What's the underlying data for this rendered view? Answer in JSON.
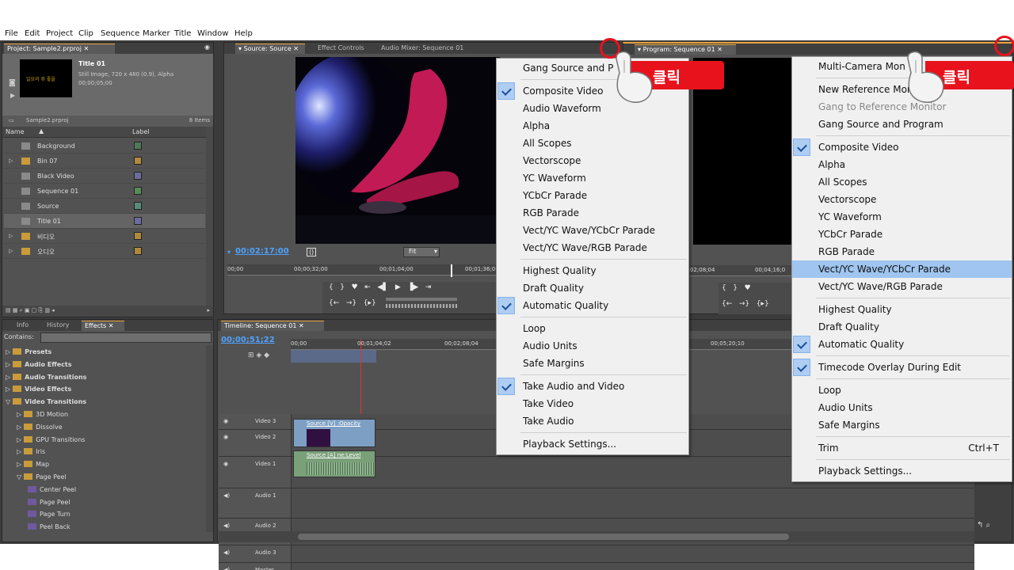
{
  "menubar": [
    "File",
    "Edit",
    "Project",
    "Clip",
    "Sequence",
    "Marker",
    "Title",
    "Window",
    "Help"
  ],
  "project": {
    "tab": "Project: Sample2.prproj",
    "title": "Title 01",
    "info1": "Still Image, 720 x 480 (0.9), Alpha",
    "info2": "00;00;05;00",
    "filename": "Sample2.prproj",
    "count": "8 Items",
    "col_name": "Name",
    "col_label": "Label",
    "items": [
      {
        "name": "Background",
        "color": "#4f7a5a"
      },
      {
        "name": "Bin 07",
        "color": "#b08a3a"
      },
      {
        "name": "Black Video",
        "color": "#6c6ca0"
      },
      {
        "name": "Sequence 01",
        "color": "#5a8a5a"
      },
      {
        "name": "Source",
        "color": "#5a8a7a"
      },
      {
        "name": "Title 01",
        "color": "#6c6ca0"
      },
      {
        "name": "비디오",
        "color": "#b08a3a"
      },
      {
        "name": "오디오",
        "color": "#b08a3a"
      }
    ]
  },
  "effects": {
    "tabs": [
      "Info",
      "History",
      "Effects"
    ],
    "contains": "Contains:",
    "items": [
      "Presets",
      "Audio Effects",
      "Audio Transitions",
      "Video Effects",
      "Video Transitions",
      "3D Motion",
      "Dissolve",
      "GPU Transitions",
      "Iris",
      "Map",
      "Page Peel",
      "Center Peel",
      "Page Peel",
      "Page Turn",
      "Peel Back"
    ]
  },
  "source": {
    "tabs": [
      "Source: Source",
      "Effect Controls",
      "Audio Mixer: Sequence 01"
    ],
    "timecode": "00:02:17:00",
    "fit": "Fit",
    "ruler": [
      "00;00",
      "00;00;32;00",
      "00;01;04;00",
      "00;01;36;0"
    ]
  },
  "program": {
    "tab": "Program: Sequence 01",
    "ruler": [
      "02;08;04",
      "00;04;16;0"
    ]
  },
  "timeline": {
    "tab": "Timeline: Sequence 01",
    "timecode": "00;00;51;22",
    "ruler": [
      "00;00",
      "00;01;04;02",
      "00;02;08;04",
      "00;05;20;10"
    ],
    "tracks": [
      "Video 3",
      "Video 2",
      "Video 1",
      "Audio 1",
      "Audio 2",
      "Audio 3",
      "Master"
    ],
    "clip_v1": "Source [V] :Opacity",
    "clip_a1": "Source [A] ne:Level"
  },
  "menu_left": {
    "items": [
      {
        "label": "Gang Source and P",
        "checked": false
      },
      {
        "label": "Composite Video",
        "checked": true
      },
      {
        "label": "Audio Waveform",
        "checked": false
      },
      {
        "label": "Alpha",
        "checked": false
      },
      {
        "label": "All Scopes",
        "checked": false
      },
      {
        "label": "Vectorscope",
        "checked": false
      },
      {
        "label": "YC Waveform",
        "checked": false
      },
      {
        "label": "YCbCr Parade",
        "checked": false
      },
      {
        "label": "RGB Parade",
        "checked": false
      },
      {
        "label": "Vect/YC Wave/YCbCr Parade",
        "checked": false
      },
      {
        "label": "Vect/YC Wave/RGB Parade",
        "checked": false
      },
      {
        "label": "Highest Quality",
        "checked": false
      },
      {
        "label": "Draft Quality",
        "checked": false
      },
      {
        "label": "Automatic Quality",
        "checked": true
      },
      {
        "label": "Loop",
        "checked": false
      },
      {
        "label": "Audio Units",
        "checked": false
      },
      {
        "label": "Safe Margins",
        "checked": false
      },
      {
        "label": "Take Audio and Video",
        "checked": true
      },
      {
        "label": "Take Video",
        "checked": false
      },
      {
        "label": "Take Audio",
        "checked": false
      },
      {
        "label": "Playback Settings...",
        "checked": false
      }
    ]
  },
  "menu_right": {
    "items": [
      {
        "label": "Multi-Camera Mon",
        "checked": false
      },
      {
        "label": "New Reference Monit",
        "checked": false
      },
      {
        "label": "Gang to Reference Monitor",
        "checked": false,
        "disabled": true
      },
      {
        "label": "Gang Source and Program",
        "checked": false
      },
      {
        "label": "Composite Video",
        "checked": true
      },
      {
        "label": "Alpha",
        "checked": false
      },
      {
        "label": "All Scopes",
        "checked": false
      },
      {
        "label": "Vectorscope",
        "checked": false
      },
      {
        "label": "YC Waveform",
        "checked": false
      },
      {
        "label": "YCbCr Parade",
        "checked": false
      },
      {
        "label": "RGB Parade",
        "checked": false
      },
      {
        "label": "Vect/YC Wave/YCbCr Parade",
        "checked": false,
        "highlighted": true
      },
      {
        "label": "Vect/YC Wave/RGB Parade",
        "checked": false
      },
      {
        "label": "Highest Quality",
        "checked": false
      },
      {
        "label": "Draft Quality",
        "checked": false
      },
      {
        "label": "Automatic Quality",
        "checked": true
      },
      {
        "label": "Timecode Overlay During Edit",
        "checked": true
      },
      {
        "label": "Loop",
        "checked": false
      },
      {
        "label": "Audio Units",
        "checked": false
      },
      {
        "label": "Safe Margins",
        "checked": false
      },
      {
        "label": "Trim",
        "checked": false,
        "shortcut": "Ctrl+T"
      },
      {
        "label": "Playback Settings...",
        "checked": false
      }
    ]
  },
  "callouts": [
    "클릭",
    "클릭"
  ],
  "colors": {
    "accent": "#e8a33d",
    "callout": "#e8121c",
    "highlight": "#9fc5f0"
  }
}
